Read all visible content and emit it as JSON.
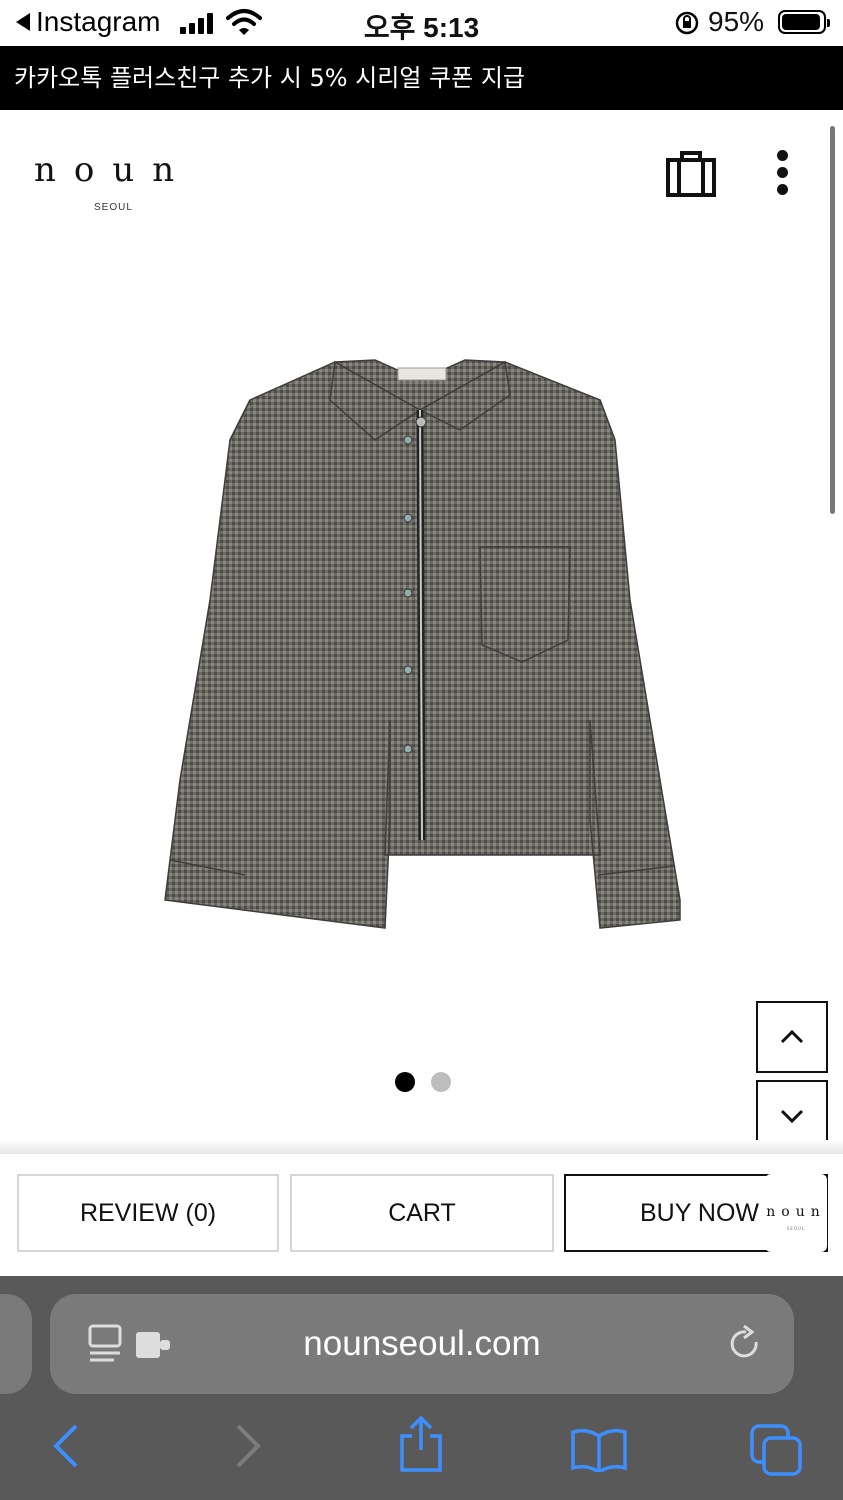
{
  "status_bar": {
    "back_app": "Instagram",
    "time": "오후 5:13",
    "battery": "95%"
  },
  "banner": {
    "text": "카카오톡 플러스친구 추가 시 5% 시리얼 쿠폰 지급"
  },
  "header": {
    "logo": "noun",
    "logo_sub": "SEOUL",
    "icons": [
      "shopping-bag-icon",
      "more-menu-icon"
    ]
  },
  "product": {
    "image": "houndstooth-zip-up-shirt-jacket",
    "carousel": {
      "current": 1,
      "total": 2,
      "active_color": "#000000",
      "inactive_color": "#bdbdbd"
    }
  },
  "scroll_buttons": [
    "chevron-up-icon",
    "chevron-down-icon"
  ],
  "actions": {
    "review": "REVIEW (0)",
    "cart": "CART",
    "buy": "BUY NOW",
    "floating_logo": "noun",
    "floating_logo_sub": "SEOUL"
  },
  "browser": {
    "url": "nounseoul.com",
    "toolbar": [
      "back-icon",
      "forward-icon",
      "share-icon",
      "bookmarks-icon",
      "tabs-icon"
    ],
    "accent": "#3d8fff"
  }
}
